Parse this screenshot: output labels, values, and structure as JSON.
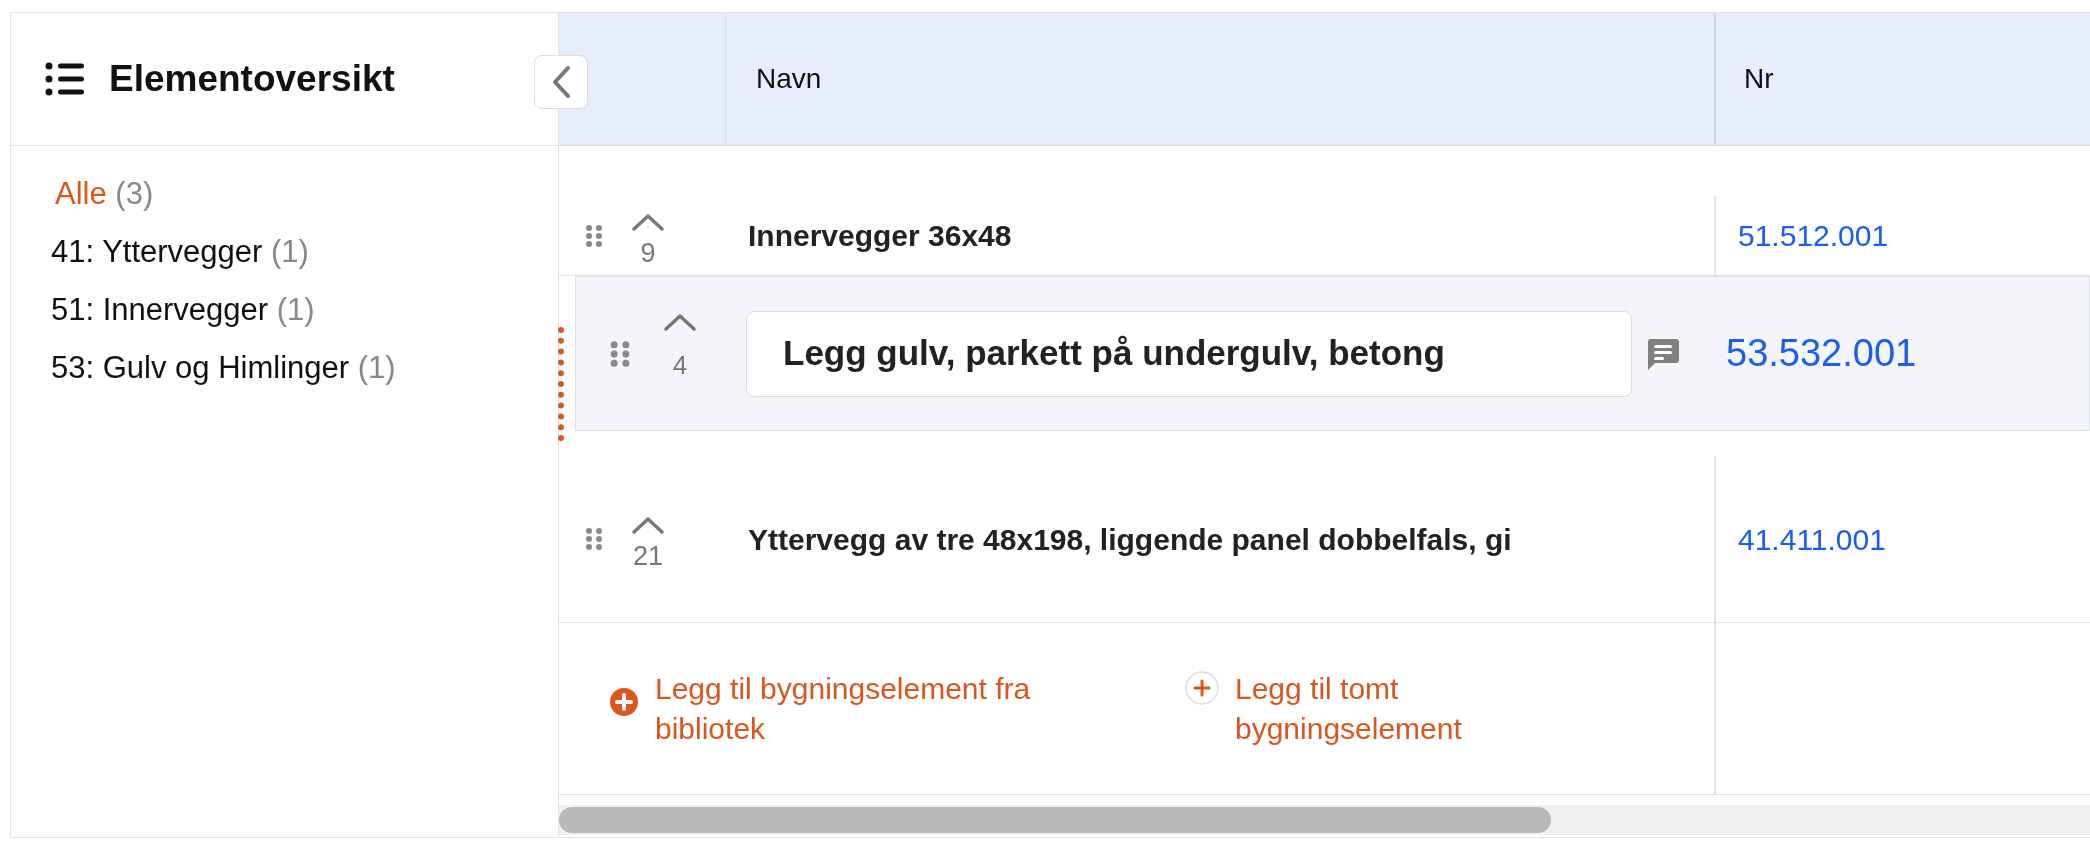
{
  "panel": {
    "title": "Elementoversikt"
  },
  "categories": [
    {
      "label": "Alle",
      "count": "(3)",
      "selected": true
    },
    {
      "label": "41: Yttervegger",
      "count": "(1)",
      "selected": false
    },
    {
      "label": "51: Innervegger",
      "count": "(1)",
      "selected": false
    },
    {
      "label": "53: Gulv og Himlinger",
      "count": "(1)",
      "selected": false
    }
  ],
  "table": {
    "columns": [
      "Navn",
      "Nr"
    ],
    "rows": [
      {
        "order": "9",
        "name": "Innervegger 36x48",
        "number": "51.512.001",
        "dragging": false
      },
      {
        "order": "4",
        "name": "Legg gulv, parkett på undergulv, betong",
        "number": "53.532.001",
        "dragging": true
      },
      {
        "order": "21",
        "name": "Yttervegg av tre 48x198, liggende panel dobbelfals, gi",
        "number": "41.411.001",
        "dragging": false
      }
    ]
  },
  "actions": [
    {
      "label": "Legg til bygningselement fra bibliotek",
      "kind": "filled"
    },
    {
      "label": "Legg til tomt bygningselement",
      "kind": "outline"
    }
  ]
}
